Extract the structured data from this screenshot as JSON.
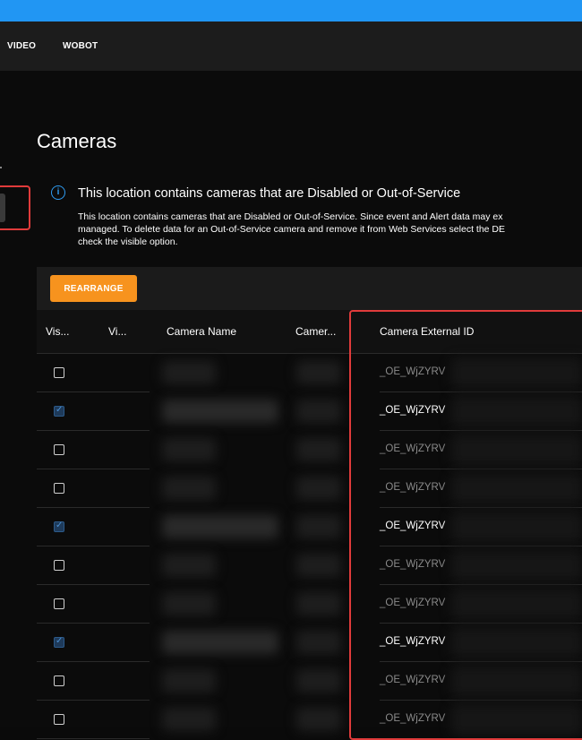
{
  "nav": {
    "items": [
      "VIDEO",
      "WOBOT"
    ]
  },
  "page": {
    "title": "Cameras"
  },
  "alert": {
    "title": "This location contains cameras that are Disabled or Out-of-Service",
    "lines": [
      "This location contains cameras that are Disabled or Out-of-Service. Since event and Alert data may ex",
      "managed. To delete data for an Out-of-Service camera and remove it from Web Services select the DE",
      "check the visible option."
    ],
    "icon": "info-icon",
    "accent": "#2f9cf2"
  },
  "toolbar": {
    "rearrange_label": "REARRANGE",
    "accent": "#f7931e"
  },
  "table": {
    "columns": [
      "Vis...",
      "Vi...",
      "Camera Name",
      "Camer...",
      "Camera External ID"
    ],
    "rows": [
      {
        "visible": false,
        "external_id": "_OE_WjZYRV"
      },
      {
        "visible": true,
        "external_id": "_OE_WjZYRV"
      },
      {
        "visible": false,
        "external_id": "_OE_WjZYRV"
      },
      {
        "visible": false,
        "external_id": "_OE_WjZYRV"
      },
      {
        "visible": true,
        "external_id": "_OE_WjZYRV"
      },
      {
        "visible": false,
        "external_id": "_OE_WjZYRV"
      },
      {
        "visible": false,
        "external_id": "_OE_WjZYRV"
      },
      {
        "visible": true,
        "external_id": "_OE_WjZYRV"
      },
      {
        "visible": false,
        "external_id": "_OE_WjZYRV"
      },
      {
        "visible": false,
        "external_id": "_OE_WjZYRV"
      }
    ]
  },
  "colors": {
    "highlight": "#e03b3b",
    "topbar": "#2196f3"
  }
}
